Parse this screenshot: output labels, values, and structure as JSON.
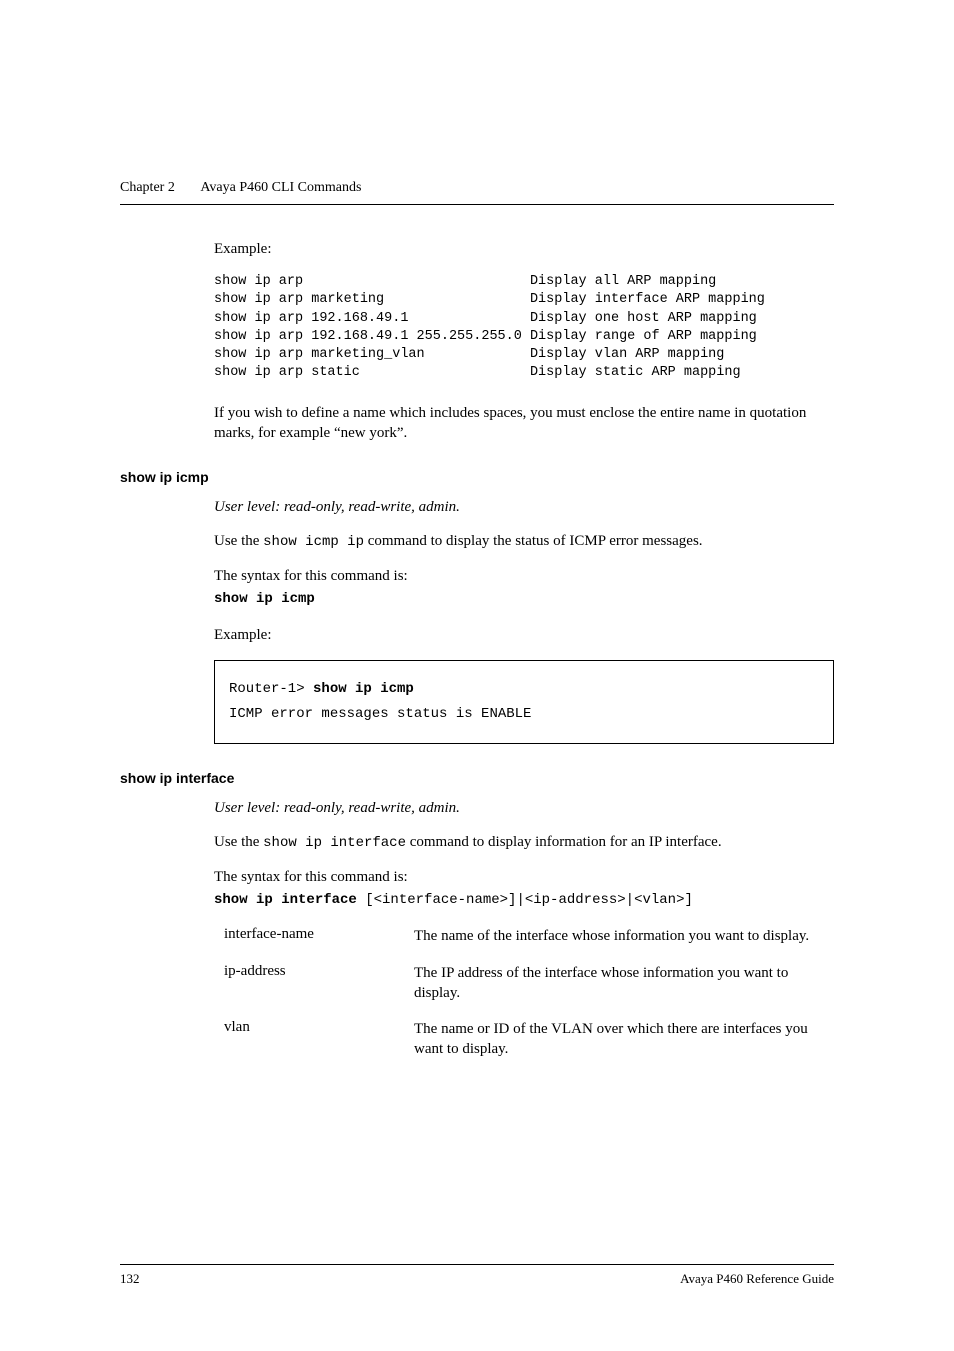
{
  "header": {
    "chapter": "Chapter 2",
    "title": "Avaya P460 CLI Commands"
  },
  "example_label": "Example:",
  "arp_example_lines": [
    "show ip arp                            Display all ARP mapping",
    "show ip arp marketing                  Display interface ARP mapping",
    "show ip arp 192.168.49.1               Display one host ARP mapping",
    "show ip arp 192.168.49.1 255.255.255.0 Display range of ARP mapping",
    "show ip arp marketing_vlan             Display vlan ARP mapping",
    "show ip arp static                     Display static ARP mapping"
  ],
  "arp_note": "If you wish to define a name which includes spaces, you must enclose the entire name in quotation marks, for example “new york”.",
  "icmp": {
    "heading": "show ip icmp",
    "user_level": "User level: read-only, read-write, admin.",
    "desc_prefix": "Use the ",
    "desc_cmd": "show icmp ip",
    "desc_suffix": " command to display the status of ICMP error messages.",
    "syntax_label": "The syntax for this command is:",
    "syntax_cmd": "show ip icmp",
    "boxed_prompt": "Router-1> ",
    "boxed_cmd": "show ip icmp",
    "boxed_output": "ICMP error messages status is ENABLE"
  },
  "interface": {
    "heading": "show ip interface",
    "user_level": "User level: read-only, read-write, admin.",
    "desc_prefix": "Use the ",
    "desc_cmd": "show ip interface",
    "desc_suffix": " command to display information for an IP interface.",
    "syntax_label": "The syntax for this command is:",
    "syntax_cmd_bold": "show ip interface",
    "syntax_cmd_args": " [<interface-name>]|<ip-address>|<vlan>]",
    "params": [
      {
        "name": "interface-name",
        "desc": "The name of the interface whose information you want to display."
      },
      {
        "name": "ip-address",
        "desc": "The IP address of the interface whose information you want to display."
      },
      {
        "name": "vlan",
        "desc": "The name or ID of the VLAN over which there are interfaces you want to display."
      }
    ]
  },
  "footer": {
    "page": "132",
    "doc": "Avaya P460 Reference Guide"
  }
}
